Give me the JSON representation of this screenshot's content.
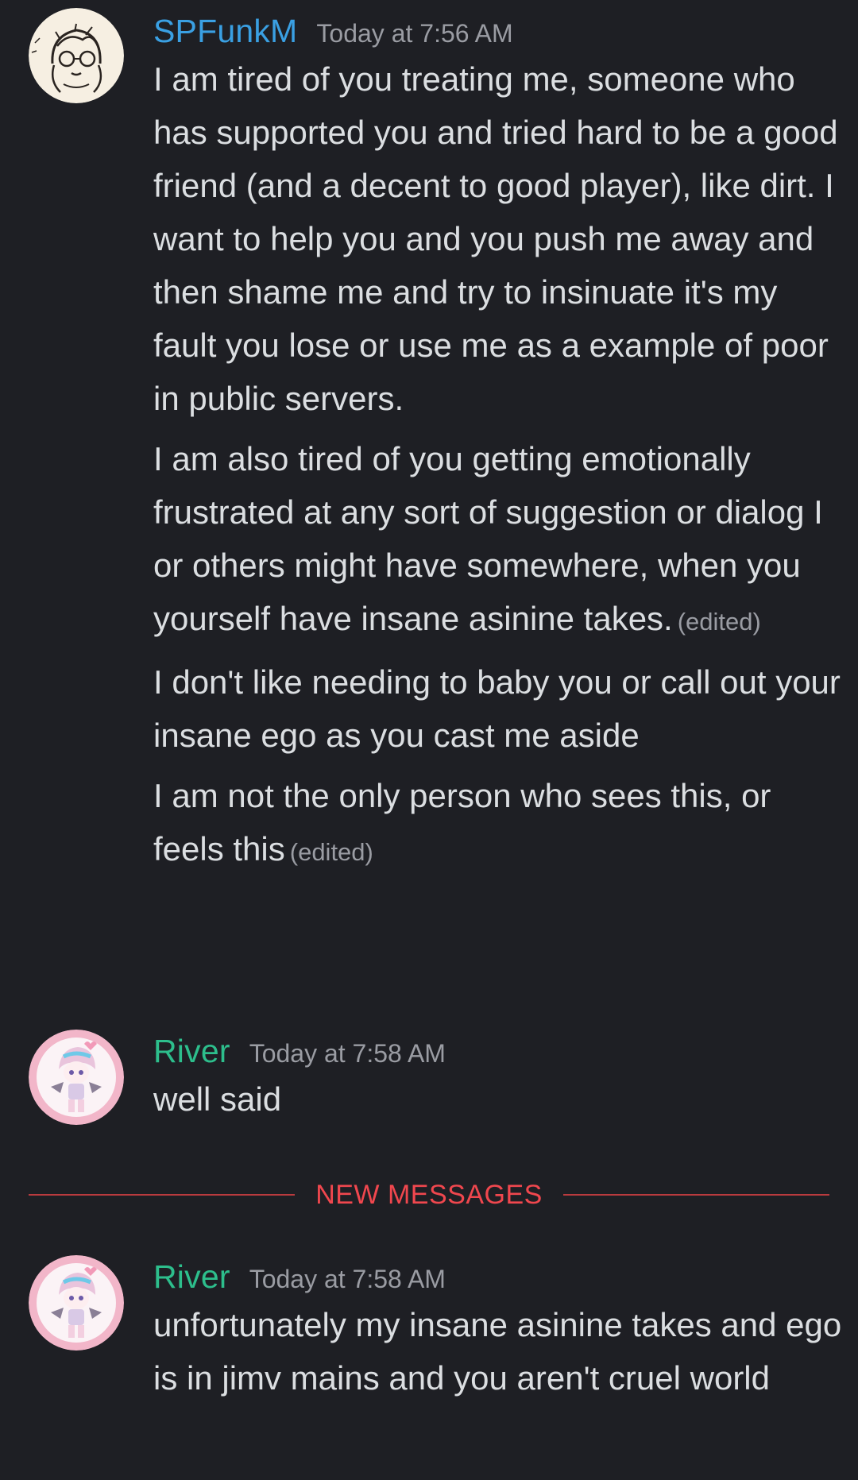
{
  "messages": [
    {
      "author": "SPFunkM",
      "timestamp": "Today at 7:56 AM",
      "avatar": "sketch-avatar",
      "name_color": "#3aa0e3",
      "lines": [
        {
          "text": "I am tired of you treating me, someone who has supported you and tried hard to be a good friend (and a decent to good player), like dirt. I want to help you and you push me away and then shame me and try to insinuate it's my fault you lose or use me as a example of poor in public servers.",
          "edited": ""
        },
        {
          "text": "I am also tired of you getting emotionally frustrated at any sort of suggestion or dialog I or others might have somewhere, when you yourself have insane asinine takes.",
          "edited": "(edited)"
        },
        {
          "text": "I don't like needing to baby you or call out your insane ego as you cast me aside",
          "edited": ""
        },
        {
          "text": "I am not the only person who sees this, or feels this",
          "edited": "(edited)"
        }
      ]
    },
    {
      "author": "River",
      "timestamp": "Today at 7:58 AM",
      "avatar": "chibi-avatar",
      "name_color": "#2dbe8c",
      "lines": [
        {
          "text": "well said",
          "edited": ""
        }
      ]
    },
    {
      "author": "River",
      "timestamp": "Today at 7:58 AM",
      "avatar": "chibi-avatar",
      "name_color": "#2dbe8c",
      "lines": [
        {
          "text": "unfortunately my insane asinine takes and ego is in jimv mains and you aren't cruel world",
          "edited": ""
        }
      ]
    }
  ],
  "divider": {
    "label": "NEW MESSAGES",
    "color": "#f0474e"
  },
  "colors": {
    "background": "#1e1f24",
    "text": "#dbdee1",
    "muted": "#9a9ca3"
  }
}
